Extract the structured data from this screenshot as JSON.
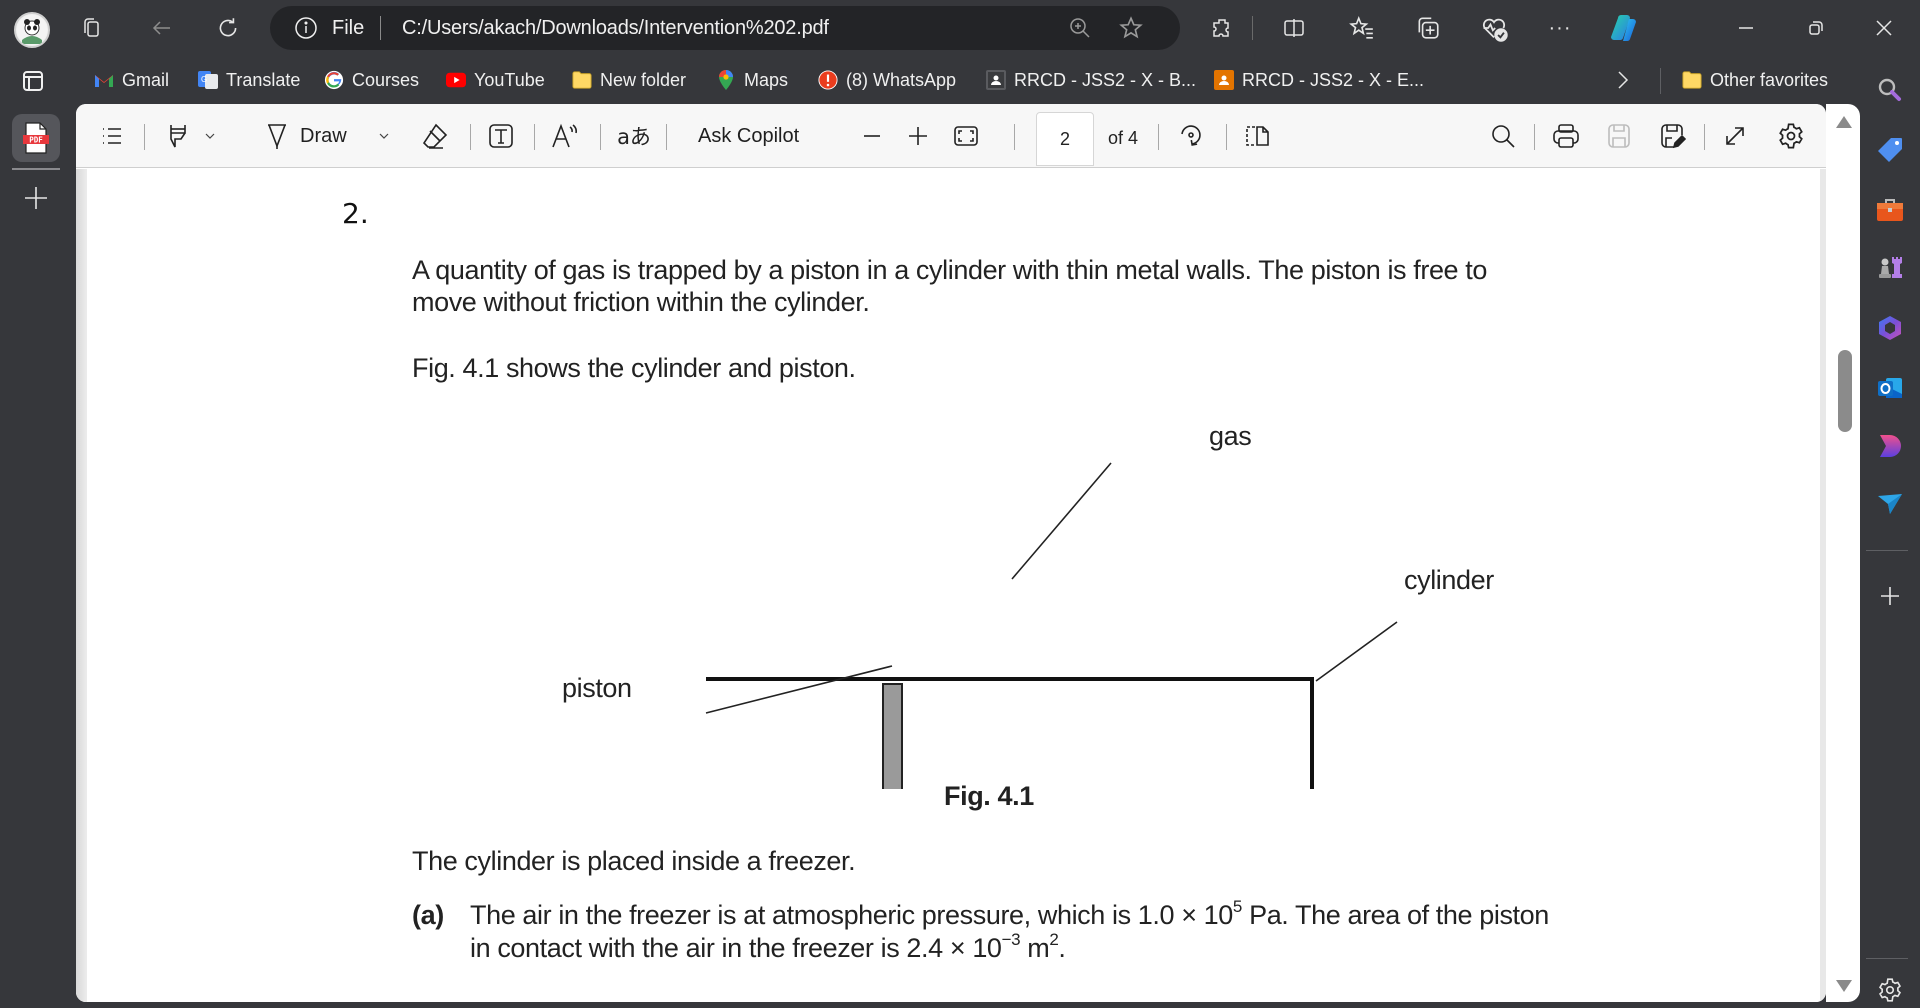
{
  "browser": {
    "address_bar": {
      "scheme_label": "File",
      "url": "C:/Users/akach/Downloads/Intervention%202.pdf"
    },
    "window_controls": [
      "minimize",
      "restore",
      "close"
    ],
    "toolbar_icons": [
      "zoom-in-icon",
      "favorite-star-icon",
      "extensions-icon",
      "split-screen-icon",
      "favorites-icon",
      "collections-icon",
      "browser-essentials-icon",
      "more-icon",
      "copilot-icon"
    ]
  },
  "favorites": {
    "items": [
      {
        "label": "Gmail",
        "icon": "gmail-icon"
      },
      {
        "label": "Translate",
        "icon": "translate-icon"
      },
      {
        "label": "Courses",
        "icon": "google-icon"
      },
      {
        "label": "YouTube",
        "icon": "youtube-icon"
      },
      {
        "label": "New folder",
        "icon": "folder-icon"
      },
      {
        "label": "Maps",
        "icon": "maps-icon"
      },
      {
        "label": "(8) WhatsApp",
        "icon": "alert-icon"
      },
      {
        "label": "RRCD - JSS2 - X - B...",
        "icon": "classroom-icon"
      },
      {
        "label": "RRCD - JSS2 - X - E...",
        "icon": "classroom-icon"
      }
    ],
    "more_label": ">",
    "other_favorites": "Other favorites"
  },
  "pdf_toolbar": {
    "draw_label": "Draw",
    "ask_copilot_label": "Ask Copilot",
    "translate_glyph": "aあ",
    "read_aloud_glyph": "A",
    "page_current": "2",
    "page_total_label": "of 4"
  },
  "document": {
    "question_number": "2.",
    "para1_line1": "A quantity of gas is trapped by a piston in a cylinder with thin metal walls. The piston is free to",
    "para1_line2": "move without friction within the cylinder.",
    "para2": "Fig. 4.1 shows the cylinder and piston.",
    "figure": {
      "labels": {
        "gas": "gas",
        "cylinder": "cylinder",
        "piston": "piston"
      },
      "caption": "Fig. 4.1"
    },
    "para3": "The cylinder is placed inside a freezer.",
    "part_a": {
      "label": "(a)",
      "line1_pre": "The air in the freezer is at atmospheric pressure, which is 1.0 × 10",
      "line1_sup": "5",
      "line1_post": " Pa. The area of the piston",
      "line2_pre": "in contact with the air in the freezer is 2.4 × 10",
      "line2_sup": "−3",
      "line2_mid": " m",
      "line2_sup2": "2",
      "line2_post": "."
    }
  },
  "scrollbar": {
    "position_fraction": 0.28
  },
  "colors": {
    "chrome_bg": "#36373b",
    "address_bg": "#232427",
    "toolbar_bg": "#f7f7f7",
    "piston_fill": "#9a9a9a"
  }
}
